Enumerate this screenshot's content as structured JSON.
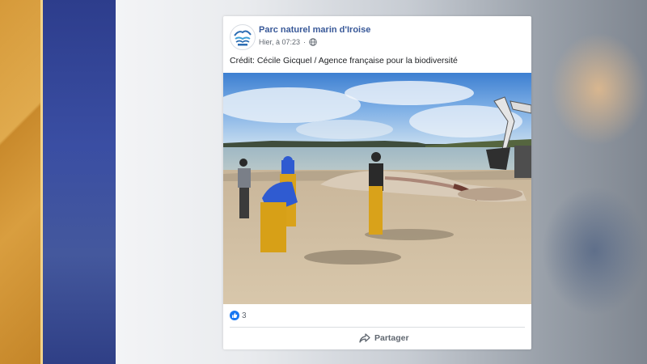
{
  "post": {
    "page_name": "Parc naturel marin d'Iroise",
    "timestamp": "Hier, à 07:23",
    "caption": "Crédit: Cécile Gicquel / Agence française pour la biodiversité",
    "reaction_count": "3",
    "share_label": "Partager"
  },
  "icons": {
    "avatar": "marine-park-logo",
    "audience": "globe-icon",
    "reaction": "like-icon",
    "share": "share-arrow-icon"
  },
  "colors": {
    "page_name": "#385898",
    "like_blue": "#1877f2",
    "muted_text": "#606770"
  }
}
